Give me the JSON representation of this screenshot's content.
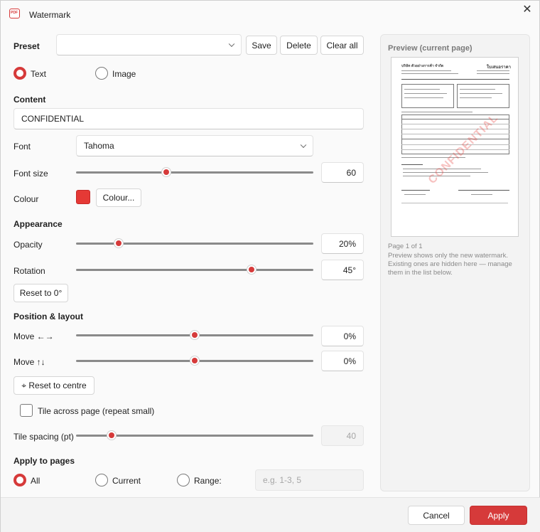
{
  "window": {
    "title": "Watermark",
    "app_icon_text": "PDF",
    "close_glyph": "✕"
  },
  "preset": {
    "label": "Preset",
    "value": "",
    "save": "Save",
    "delete": "Delete",
    "clear_all": "Clear all"
  },
  "type": {
    "text": "Text",
    "image": "Image",
    "selected": "Text"
  },
  "content": {
    "heading": "Content",
    "value": "CONFIDENTIAL"
  },
  "font": {
    "label": "Font",
    "value": "Tahoma"
  },
  "font_size": {
    "label": "Font size",
    "value": "60",
    "slider_fraction": 0.38
  },
  "colour": {
    "label": "Colour",
    "button": "Colour...",
    "swatch": "#e53935"
  },
  "appearance": {
    "heading": "Appearance",
    "opacity": {
      "label": "Opacity",
      "value": "20%",
      "slider_fraction": 0.18
    },
    "rotation": {
      "label": "Rotation",
      "value": "45°",
      "slider_fraction": 0.74
    },
    "reset": "Reset to 0°"
  },
  "position": {
    "heading": "Position & layout",
    "move_x": {
      "label": "Move ←→",
      "value": "0%",
      "slider_fraction": 0.5
    },
    "move_y": {
      "label": "Move ↑↓",
      "value": "0%",
      "slider_fraction": 0.5
    },
    "reset": "⌖  Reset to centre",
    "tile": "Tile across page (repeat small)",
    "tile_spacing": {
      "label": "Tile spacing (pt)",
      "value": "40",
      "slider_fraction": 0.15
    }
  },
  "pages": {
    "heading": "Apply to pages",
    "all": "All",
    "current": "Current",
    "range": "Range:",
    "range_placeholder": "e.g. 1-3, 5",
    "selected": "All"
  },
  "preview": {
    "title": "Preview (current page)",
    "page_info": "Page 1 of 1",
    "note": "Preview shows only the new watermark. Existing ones are hidden here — manage them in the list below.",
    "watermark_text": "CONFIDENTIAL",
    "doc_company": "บริษัท ตัวอย่างการค้า จำกัด",
    "doc_title": "ใบเสนอราคา"
  },
  "footer": {
    "cancel": "Cancel",
    "apply": "Apply"
  },
  "colors": {
    "accent": "#d63a3a",
    "panel": "#f3f3f3"
  }
}
